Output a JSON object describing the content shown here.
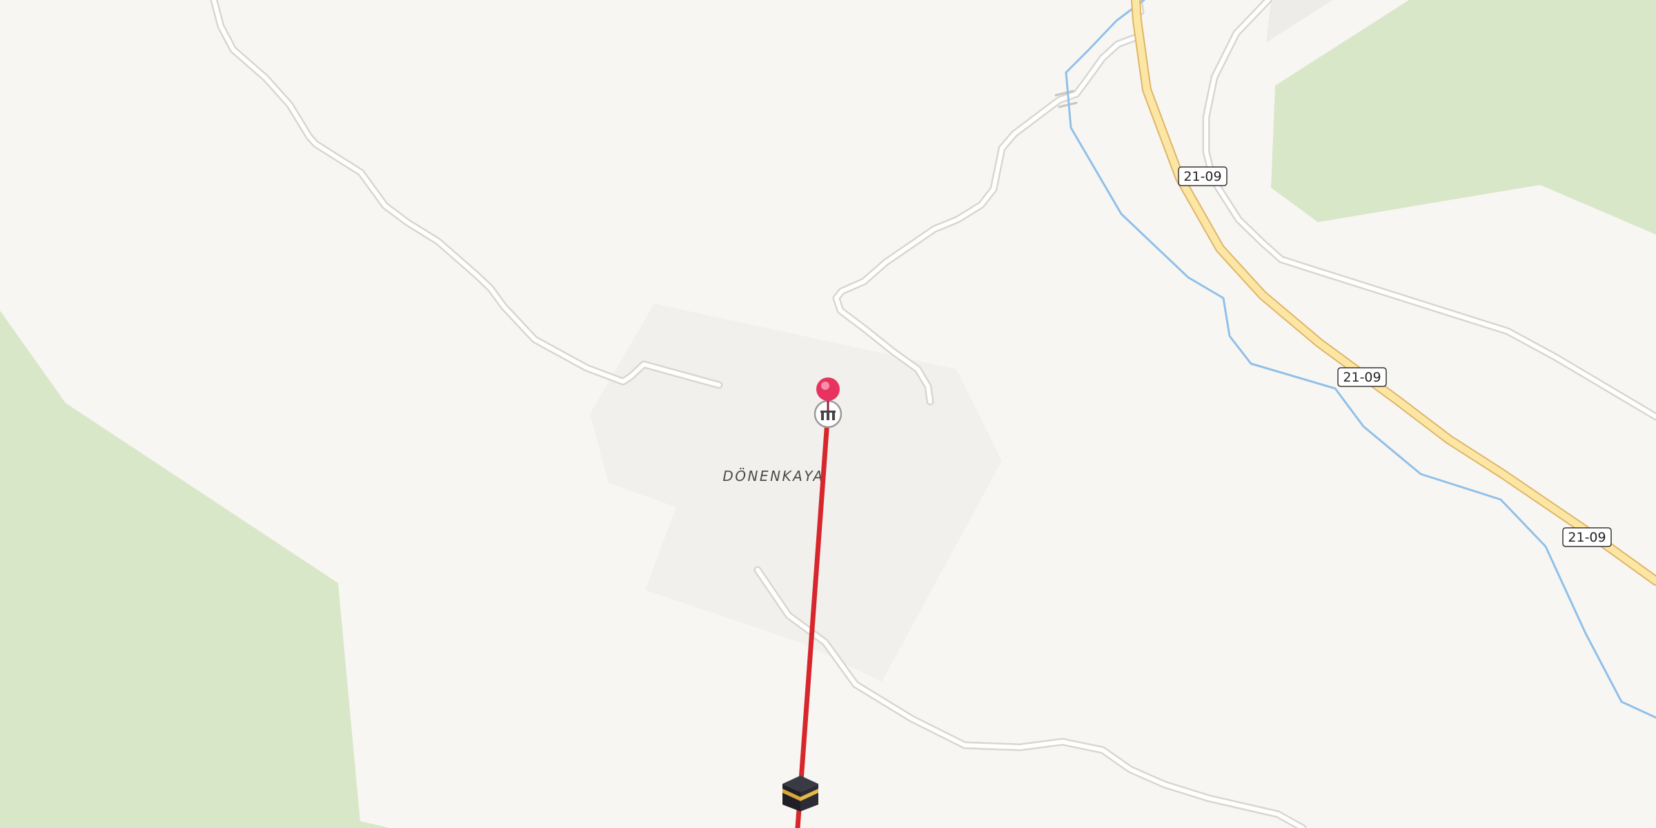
{
  "map": {
    "place_label": "DÖNENKAYA",
    "road_shields": [
      {
        "ref": "21-09"
      },
      {
        "ref": "21-09"
      },
      {
        "ref": "21-09"
      }
    ],
    "markers": {
      "pin": {
        "icon": "map-pin-icon",
        "color": "#e8325f"
      },
      "mosque": {
        "icon": "mosque-icon"
      },
      "kaaba": {
        "icon": "kaaba-icon"
      }
    },
    "qibla_line": {
      "color": "#d7262c"
    },
    "colors": {
      "background": "#f8f6f2",
      "wood": "#d9e7c9",
      "settlement": "#f1efec",
      "primary_road_fill": "#fce6a4",
      "primary_road_casing": "#e0b467",
      "minor_road_fill": "#ffffff",
      "minor_road_casing": "#d9d6d1",
      "stream": "#8fc0ea"
    }
  }
}
